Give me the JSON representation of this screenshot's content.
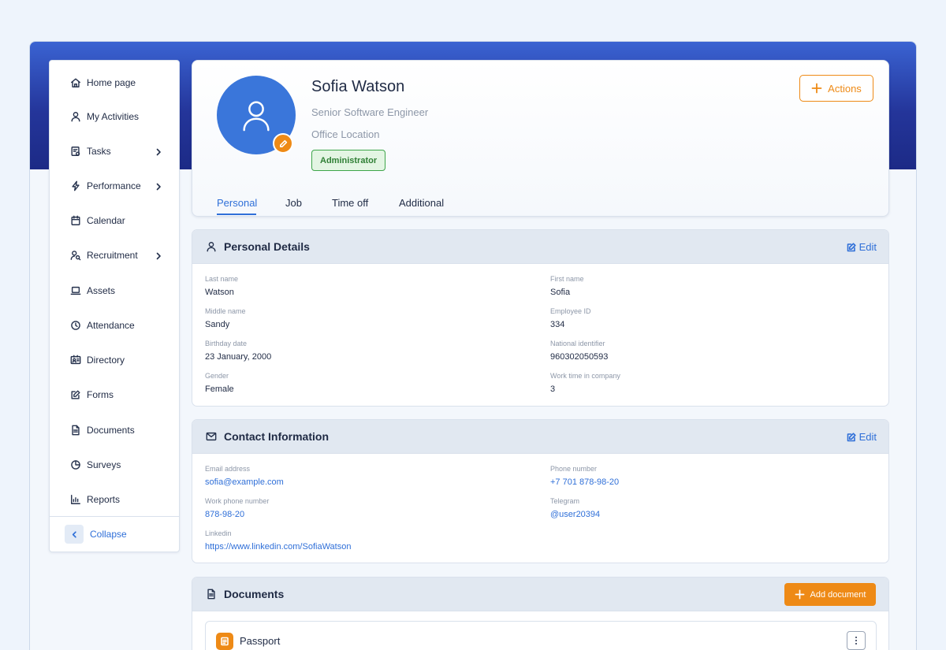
{
  "sidebar": {
    "items": [
      {
        "label": "Home page",
        "icon": "home-icon"
      },
      {
        "label": "My Activities",
        "icon": "user-icon"
      },
      {
        "label": "Tasks",
        "icon": "tasks-icon",
        "has_children": true
      },
      {
        "label": "Performance",
        "icon": "bolt-icon",
        "has_children": true
      },
      {
        "label": "Calendar",
        "icon": "calendar-icon"
      },
      {
        "label": "Recruitment",
        "icon": "recruitment-icon",
        "has_children": true
      },
      {
        "label": "Assets",
        "icon": "laptop-icon"
      },
      {
        "label": "Attendance",
        "icon": "clock-icon"
      },
      {
        "label": "Directory",
        "icon": "id-card-icon"
      },
      {
        "label": "Forms",
        "icon": "form-edit-icon"
      },
      {
        "label": "Documents",
        "icon": "document-icon"
      },
      {
        "label": "Surveys",
        "icon": "pie-chart-icon"
      },
      {
        "label": "Reports",
        "icon": "bar-chart-icon"
      }
    ],
    "collapse_label": "Collapse"
  },
  "profile": {
    "name": "Sofia Watson",
    "role": "Senior Software Engineer",
    "location": "Office Location",
    "badge": "Administrator",
    "actions_label": "Actions",
    "tabs": [
      {
        "label": "Personal",
        "active": true
      },
      {
        "label": "Job",
        "active": false
      },
      {
        "label": "Time off",
        "active": false
      },
      {
        "label": "Additional",
        "active": false
      }
    ]
  },
  "personal_details": {
    "title": "Personal Details",
    "edit_label": "Edit",
    "fields": [
      {
        "label": "Last name",
        "value": "Watson"
      },
      {
        "label": "First name",
        "value": "Sofia"
      },
      {
        "label": "Middle name",
        "value": "Sandy"
      },
      {
        "label": "Employee ID",
        "value": "334"
      },
      {
        "label": "Birthday date",
        "value": "23 January, 2000"
      },
      {
        "label": "National identifier",
        "value": "960302050593"
      },
      {
        "label": "Gender",
        "value": "Female"
      },
      {
        "label": "Work time in company",
        "value": "3"
      }
    ]
  },
  "contact_info": {
    "title": "Contact Information",
    "edit_label": "Edit",
    "fields": [
      {
        "label": "Email address",
        "value": "sofia@example.com"
      },
      {
        "label": "Phone number",
        "value": "+7 701 878-98-20"
      },
      {
        "label": "Work phone number",
        "value": "878-98-20"
      },
      {
        "label": "Telegram",
        "value": "@user20394"
      },
      {
        "label": "Linkedin",
        "value": "https://www.linkedin.com/SofiaWatson"
      }
    ]
  },
  "documents": {
    "title": "Documents",
    "add_label": "Add document",
    "items": [
      {
        "name": "Passport"
      }
    ]
  },
  "colors": {
    "accent_blue": "#2f6fd8",
    "accent_orange": "#ee8a16",
    "badge_green": "#3ea64a",
    "header_navy": "#1c2a86"
  }
}
